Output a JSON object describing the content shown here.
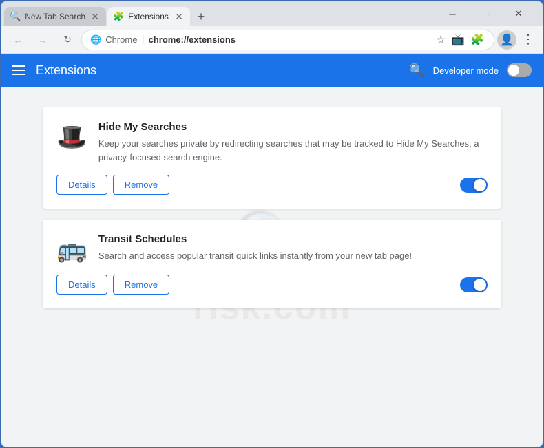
{
  "browser": {
    "tabs": [
      {
        "id": "tab-new-tab-search",
        "title": "New Tab Search",
        "icon": "🔍",
        "active": false
      },
      {
        "id": "tab-extensions",
        "title": "Extensions",
        "icon": "🧩",
        "active": true
      }
    ],
    "new_tab_button": "+",
    "window_controls": {
      "minimize": "─",
      "maximize": "□",
      "close": "✕"
    },
    "nav": {
      "back": "←",
      "forward": "→",
      "refresh": "↻",
      "address_globe": "🌐",
      "address_divider": "|",
      "address_prefix": "Chrome",
      "address_url": "chrome://extensions",
      "bookmark_icon": "☆",
      "profile_icon": "👤",
      "menu_icon": "⋮"
    }
  },
  "extensions_page": {
    "header": {
      "hamburger_label": "Menu",
      "title": "Extensions",
      "search_label": "Search",
      "developer_mode_label": "Developer mode",
      "developer_mode_on": false
    },
    "extensions": [
      {
        "id": "hide-my-searches",
        "icon": "🎩",
        "title": "Hide My Searches",
        "description": "Keep your searches private by redirecting searches that may be tracked to Hide My Searches, a privacy-focused search engine.",
        "details_label": "Details",
        "remove_label": "Remove",
        "enabled": true
      },
      {
        "id": "transit-schedules",
        "icon": "🚌",
        "title": "Transit Schedules",
        "description": "Search and access popular transit quick links instantly from your new tab page!",
        "details_label": "Details",
        "remove_label": "Remove",
        "enabled": true
      }
    ]
  }
}
